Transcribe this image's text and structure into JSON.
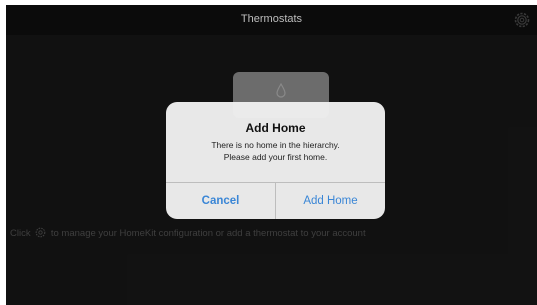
{
  "navbar": {
    "title": "Thermostats",
    "settings_icon": "gear-icon"
  },
  "main": {
    "hint_prefix": "Click",
    "hint_suffix": "to manage your HomeKit configuration or add a thermostat to your account",
    "placeholder_icon": "drop-icon"
  },
  "alert": {
    "title": "Add Home",
    "message_line1": "There is no home in the hierarchy.",
    "message_line2": "Please add your first home.",
    "cancel_label": "Cancel",
    "confirm_label": "Add Home"
  },
  "colors": {
    "background": "#050505",
    "alert_background": "#f0f0f0",
    "button_text": "#3a86d6"
  }
}
